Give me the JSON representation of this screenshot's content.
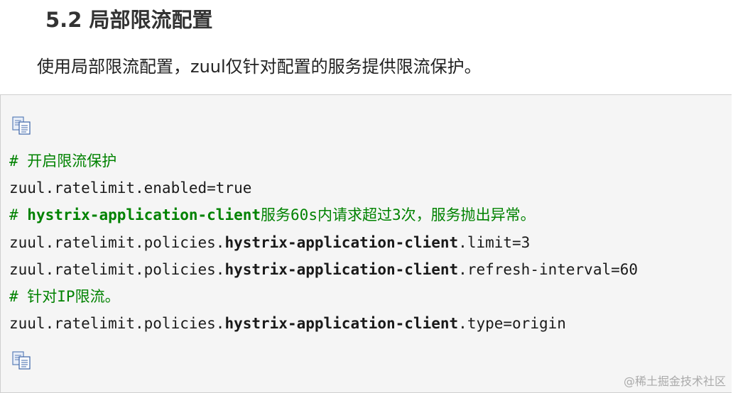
{
  "section": {
    "heading": "5.2 局部限流配置",
    "intro": "使用局部限流配置，zuul仅针对配置的服务提供限流保护。"
  },
  "code": {
    "lines": [
      {
        "type": "comment",
        "parts": [
          {
            "text": "# 开启限流保护"
          }
        ]
      },
      {
        "type": "code",
        "parts": [
          {
            "text": "zuul.ratelimit.enabled=true"
          }
        ]
      },
      {
        "type": "comment",
        "parts": [
          {
            "text": "# "
          },
          {
            "text": "hystrix-application-client",
            "bold": true
          },
          {
            "text": "服务60s内请求超过3次，服务抛出异常。"
          }
        ]
      },
      {
        "type": "code",
        "parts": [
          {
            "text": "zuul.ratelimit.policies."
          },
          {
            "text": "hystrix-application-client",
            "bold": true
          },
          {
            "text": ".limit=3"
          }
        ]
      },
      {
        "type": "code",
        "parts": [
          {
            "text": "zuul.ratelimit.policies."
          },
          {
            "text": "hystrix-application-client",
            "bold": true
          },
          {
            "text": ".refresh-interval=60"
          }
        ]
      },
      {
        "type": "comment",
        "parts": [
          {
            "text": "# 针对IP限流。"
          }
        ]
      },
      {
        "type": "code",
        "parts": [
          {
            "text": "zuul.ratelimit.policies."
          },
          {
            "text": "hystrix-application-client",
            "bold": true
          },
          {
            "text": ".type=origin"
          }
        ]
      }
    ],
    "copy_icon": "copy-icon"
  },
  "watermark": "@稀土掘金技术社区",
  "colors": {
    "comment": "#008200",
    "code_background": "#f5f5f5",
    "border": "#cfcfcf"
  }
}
